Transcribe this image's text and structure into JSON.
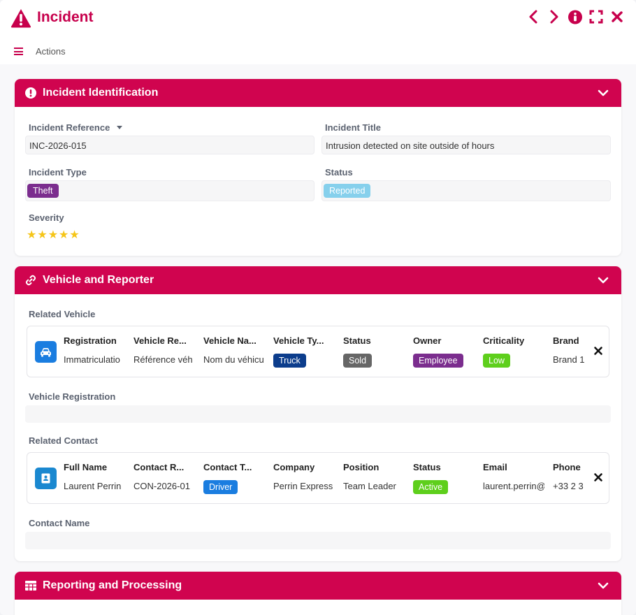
{
  "window": {
    "title": "Incident",
    "icons": [
      "warning-icon",
      "prev-icon",
      "next-icon",
      "info-icon",
      "fullscreen-icon",
      "close-icon"
    ],
    "actions_label": "Actions"
  },
  "colors": {
    "brand": "#c7004c",
    "header": "#d0044f",
    "theft": "#7b2d8e",
    "reported": "#86d0ec",
    "truck": "#0c3d8c",
    "sold": "#666666",
    "employee": "#7b2d8e",
    "low": "#5ecf1c",
    "driver": "#1a7de0",
    "active": "#5ecf1c",
    "vehicle_icon_bg": "#1a7de0",
    "contact_icon_bg": "#1a88d0"
  },
  "identification": {
    "title": "Incident Identification",
    "reference_label": "Incident Reference",
    "reference_value": "INC-2026-015",
    "title_label": "Incident Title",
    "title_value": "Intrusion detected on site outside of hours",
    "type_label": "Incident Type",
    "type_value": "Theft",
    "status_label": "Status",
    "status_value": "Reported",
    "severity_label": "Severity",
    "severity_stars": 5
  },
  "vehicle_reporter": {
    "title": "Vehicle and Reporter",
    "related_vehicle_label": "Related Vehicle",
    "vehicle": {
      "headers": [
        "Registration",
        "Vehicle Re...",
        "Vehicle Na...",
        "Vehicle Ty...",
        "Status",
        "Owner",
        "Criticality",
        "Brand"
      ],
      "values": [
        "Immatriculatio",
        "Référence véh",
        "Nom du véhicu",
        "Truck",
        "Sold",
        "Employee",
        "Low",
        "Brand 1"
      ]
    },
    "vehicle_registration_label": "Vehicle Registration",
    "related_contact_label": "Related Contact",
    "contact": {
      "headers": [
        "Full Name",
        "Contact R...",
        "Contact T...",
        "Company",
        "Position",
        "Status",
        "Email",
        "Phone"
      ],
      "values": [
        "Laurent Perrin",
        "CON-2026-01",
        "Driver",
        "Perrin Express",
        "Team Leader",
        "Active",
        "laurent.perrin@",
        "+33 2 3"
      ]
    },
    "contact_name_label": "Contact Name"
  },
  "reporting": {
    "title": "Reporting and Processing"
  }
}
